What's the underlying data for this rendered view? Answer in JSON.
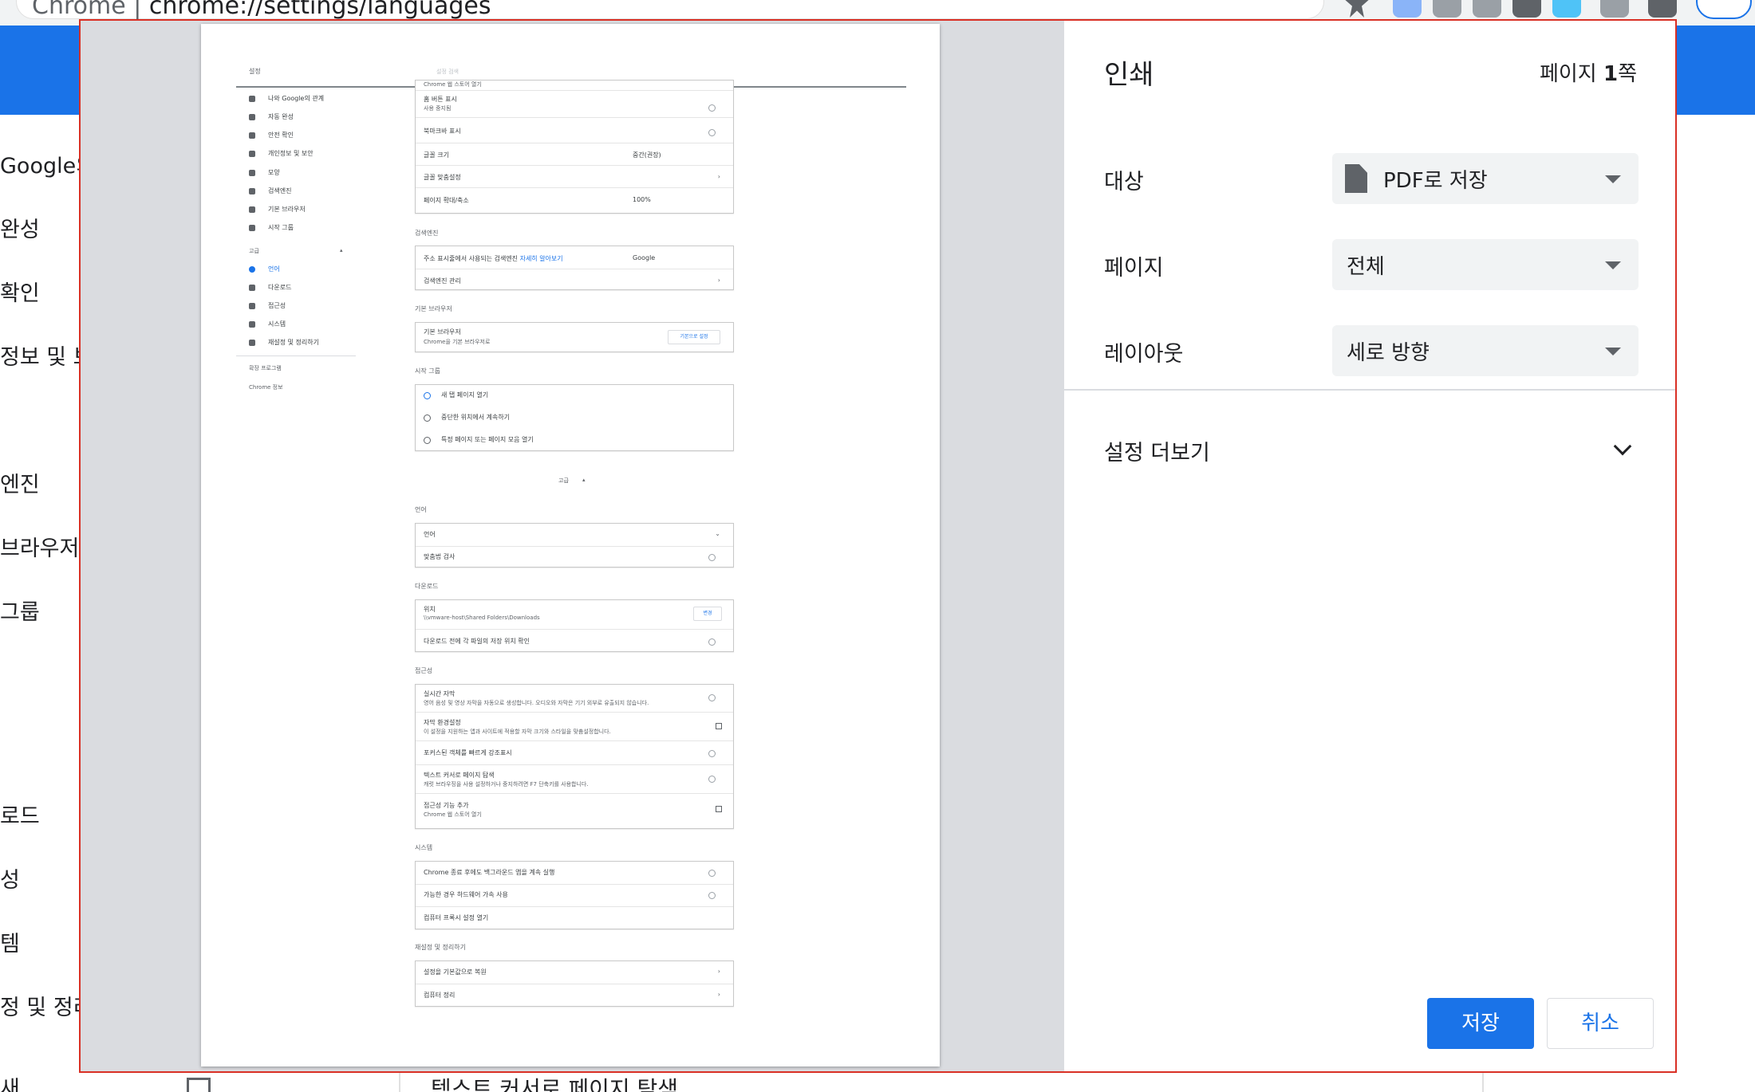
{
  "browser": {
    "omnibox_site": "Chrome",
    "omnibox_sep": "|",
    "omnibox_url": "chrome://settings/languages",
    "accent_color": "#1a73e8"
  },
  "background_settings": {
    "sidebar_items": [
      "Google의",
      "완성",
      "확인",
      "정보 및 보",
      "엔진",
      "브라우저",
      "그룹",
      "로드",
      "성",
      "템",
      "정 및 정리",
      "새"
    ],
    "card_text": "텍스트 커서로 페이지 탐색"
  },
  "print_dialog": {
    "title": "인쇄",
    "page_count_prefix": "페이지 ",
    "page_count_num": "1",
    "page_count_suffix": "쪽",
    "destination_label": "대상",
    "destination_value": "PDF로 저장",
    "pages_label": "페이지",
    "pages_value": "전체",
    "layout_label": "레이아웃",
    "layout_value": "세로 방향",
    "more_settings_label": "설정 더보기",
    "save_label": "저장",
    "cancel_label": "취소",
    "frame_color": "#d93025"
  },
  "preview": {
    "header_title": "설정",
    "header_search": "설정 검색",
    "nav_items": [
      "나와 Google의 관계",
      "자동 완성",
      "안전 확인",
      "개인정보 및 보안",
      "모양",
      "검색엔진",
      "기본 브라우저",
      "시작 그룹"
    ],
    "nav_advanced": "고급",
    "nav_adv_items": [
      "언어",
      "다운로드",
      "접근성",
      "시스템",
      "재설정 및 정리하기"
    ],
    "nav_extensions": "확장 프로그램",
    "nav_about": "Chrome 정보",
    "appearance_top": "Chrome 웹 스토어 열기",
    "home_button_title": "홈 버튼 표시",
    "home_button_sub": "사용 중지됨",
    "bookmarks_bar": "북마크바 표시",
    "font_size_label": "글꼴 크기",
    "font_size_value": "중간(권장)",
    "customize_fonts": "글꼴 맞춤설정",
    "page_zoom_label": "페이지 확대/축소",
    "page_zoom_value": "100%",
    "search_engine_heading": "검색엔진",
    "search_engine_label": "주소 표시줄에서 사용되는 검색엔진",
    "search_engine_link": "자세히 알아보기",
    "search_engine_value": "Google",
    "manage_search_engines": "검색엔진 관리",
    "default_browser_heading": "기본 브라우저",
    "default_browser_title": "기본 브라우저",
    "default_browser_sub": "Chrome을 기본 브라우저로",
    "default_browser_btn": "기본으로 설정",
    "startup_heading": "시작 그룹",
    "startup_options": [
      "새 탭 페이지 열기",
      "중단한 위치에서 계속하기",
      "특정 페이지 또는 페이지 모음 열기"
    ],
    "advanced_toggle": "고급",
    "languages_heading": "언어",
    "language_row": "언어",
    "spellcheck": "맞춤법 검사",
    "downloads_heading": "다운로드",
    "location_title": "위치",
    "location_path": "\\\\vmware-host\\Shared Folders\\Downloads",
    "location_btn": "변경",
    "ask_where": "다운로드 전에 각 파일의 저장 위치 확인",
    "accessibility_heading": "접근성",
    "live_caption_title": "실시간 자막",
    "live_caption_sub": "영어 음성 및 영상 자막을 자동으로 생성합니다. 오디오와 자막은 기기 외부로 유출되지 않습니다.",
    "caption_prefs_title": "자막 환경설정",
    "caption_prefs_sub": "이 설정을 지원하는 앱과 사이트에 적용할 자막 크기와 스타일을 맞춤설정합니다.",
    "focus_highlight": "포커스된 객체를 빠르게 강조표시",
    "caret_title": "텍스트 커서로 페이지 탐색",
    "caret_sub": "캐럿 브라우징을 사용 설정하거나 중지하려면 F7 단축키를 사용합니다.",
    "add_a11y_title": "접근성 기능 추가",
    "add_a11y_sub": "Chrome 웹 스토어 열기",
    "system_heading": "시스템",
    "background_apps": "Chrome 종료 후에도 백그라운드 앱을 계속 실행",
    "hw_accel": "가능한 경우 하드웨어 가속 사용",
    "proxy": "컴퓨터 프록시 설정 열기",
    "reset_heading": "재설정 및 정리하기",
    "restore_defaults": "설정을 기본값으로 복원",
    "cleanup": "컴퓨터 정리"
  }
}
